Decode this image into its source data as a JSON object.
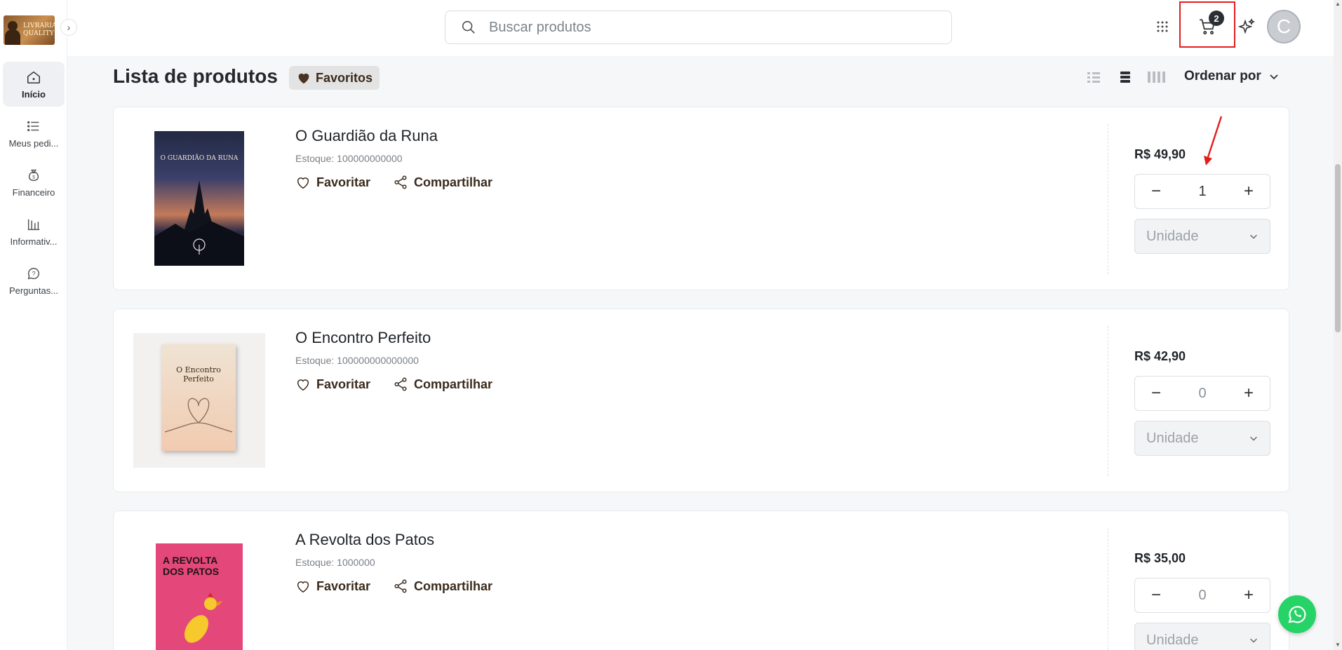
{
  "brand": {
    "logo_text": "LIVRARIA QUALITY"
  },
  "sidebar": {
    "items": [
      {
        "label": "Início",
        "icon": "home-icon",
        "active": true
      },
      {
        "label": "Meus pedi...",
        "icon": "list-icon",
        "active": false
      },
      {
        "label": "Financeiro",
        "icon": "money-bag-icon",
        "active": false
      },
      {
        "label": "Informativ...",
        "icon": "info-board-icon",
        "active": false
      },
      {
        "label": "Perguntas...",
        "icon": "help-icon",
        "active": false
      }
    ]
  },
  "topbar": {
    "search_placeholder": "Buscar produtos",
    "cart_count": "2",
    "avatar_initial": "C"
  },
  "heading": {
    "title": "Lista de produtos",
    "favorites_label": "Favoritos",
    "sort_label": "Ordenar por"
  },
  "products": [
    {
      "name": "O Guardião da Runa",
      "stock": "Estoque: 100000000000",
      "favorite_label": "Favoritar",
      "share_label": "Compartilhar",
      "price": "R$ 49,90",
      "quantity": "1",
      "unit": "Unidade",
      "cover_text": "O GUARDIÃO DA RUNA"
    },
    {
      "name": "O Encontro Perfeito",
      "stock": "Estoque: 100000000000000",
      "favorite_label": "Favoritar",
      "share_label": "Compartilhar",
      "price": "R$ 42,90",
      "quantity": "0",
      "unit": "Unidade",
      "cover_text": "O Encontro Perfeito"
    },
    {
      "name": "A Revolta dos Patos",
      "stock": "Estoque: 1000000",
      "favorite_label": "Favoritar",
      "share_label": "Compartilhar",
      "price": "R$ 35,00",
      "quantity": "0",
      "unit": "Unidade",
      "cover_text": "A REVOLTA DOS PATOS"
    }
  ],
  "colors": {
    "accent_brown": "#3a2a1c",
    "highlight_red": "#e21d1d",
    "whatsapp_green": "#25d366"
  }
}
